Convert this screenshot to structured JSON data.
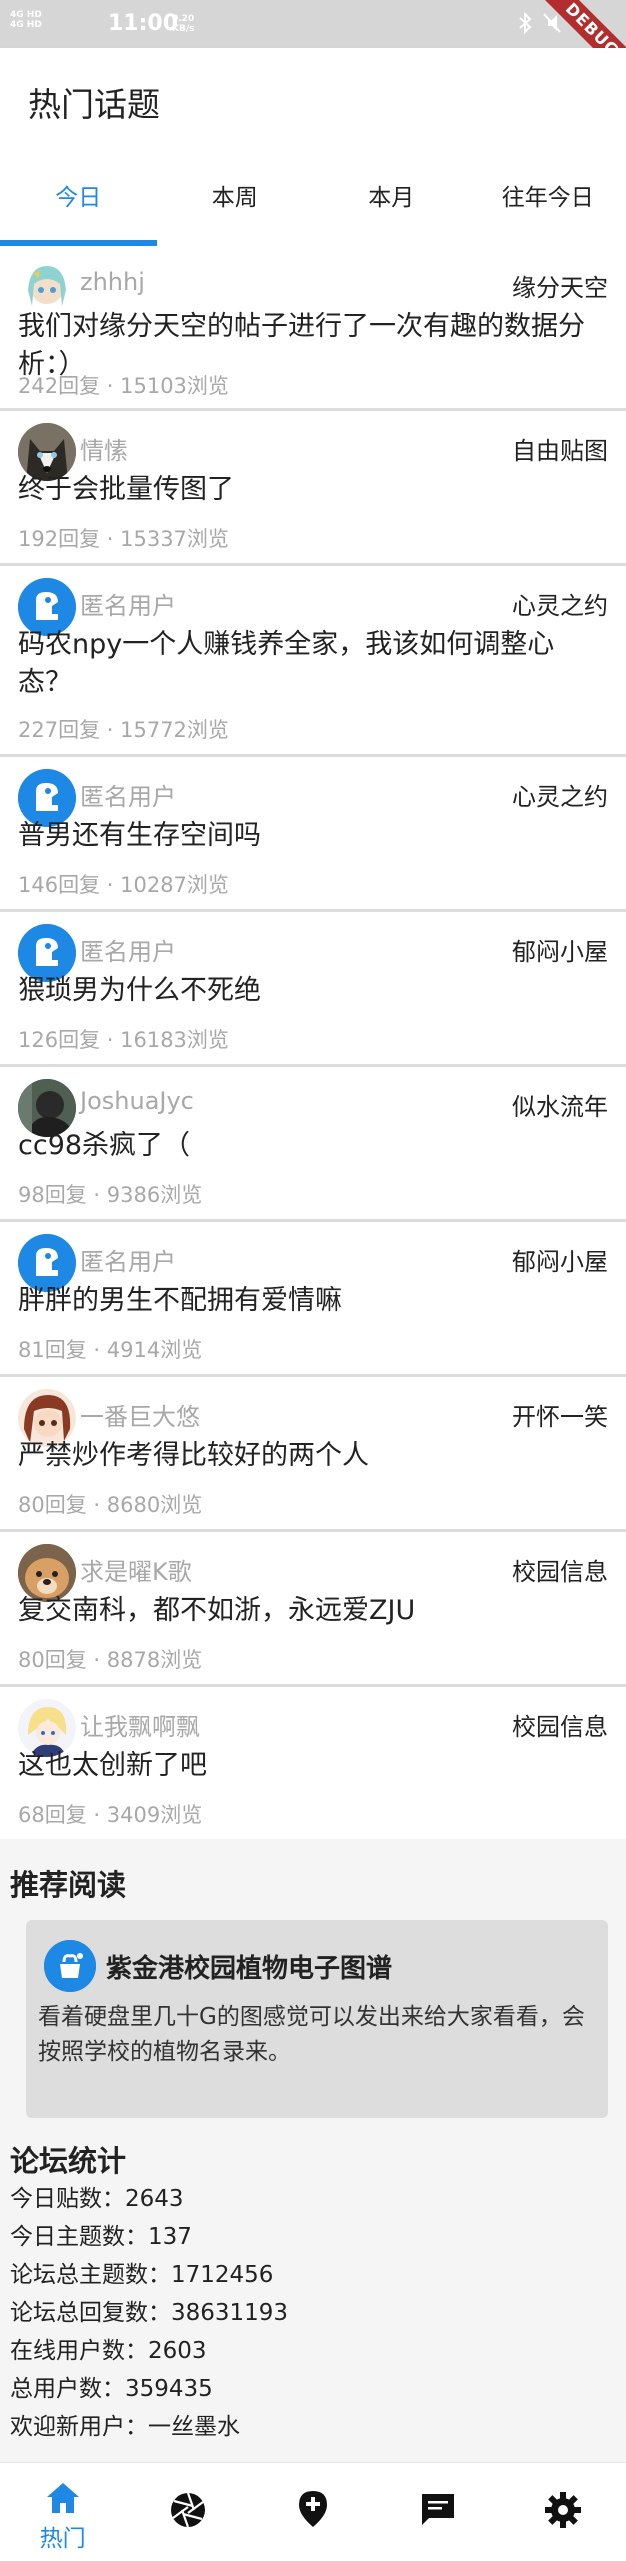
{
  "status_bar": {
    "net1": "4G HD",
    "net2": "4G HD",
    "time": "11:00",
    "speed_value": "0.20",
    "speed_unit": "KB/s",
    "debug_banner": "DEBUG"
  },
  "app_bar": {
    "title": "热门话题"
  },
  "tabs": [
    {
      "label": "今日",
      "active": true
    },
    {
      "label": "本周",
      "active": false
    },
    {
      "label": "本月",
      "active": false
    },
    {
      "label": "往年今日",
      "active": false
    }
  ],
  "topics": [
    {
      "user": "zhhhj",
      "board": "缘分天空",
      "title": "我们对缘分天空的帖子进行了一次有趣的数据分析：）",
      "meta": "242回复 · 15103浏览",
      "avatar": "anime-girl-avatar"
    },
    {
      "user": "情愫",
      "board": "自由贴图",
      "title": "终于会批量传图了",
      "meta": "192回复 · 15337浏览",
      "avatar": "husky-avatar"
    },
    {
      "user": "匿名用户",
      "board": "心灵之约",
      "title": "码农npy一个人赚钱养全家，我该如何调整心态？",
      "meta": "227回复 · 15772浏览",
      "avatar": "anonymous-avatar"
    },
    {
      "user": "匿名用户",
      "board": "心灵之约",
      "title": "普男还有生存空间吗",
      "meta": "146回复 · 10287浏览",
      "avatar": "anonymous-avatar"
    },
    {
      "user": "匿名用户",
      "board": "郁闷小屋",
      "title": "猥琐男为什么不死绝",
      "meta": "126回复 · 16183浏览",
      "avatar": "anonymous-avatar"
    },
    {
      "user": "JoshuaJyc",
      "board": "似水流年",
      "title": "cc98杀疯了（",
      "meta": "98回复 · 9386浏览",
      "avatar": "photo-avatar"
    },
    {
      "user": "匿名用户",
      "board": "郁闷小屋",
      "title": "胖胖的男生不配拥有爱情嘛",
      "meta": "81回复 · 4914浏览",
      "avatar": "anonymous-avatar"
    },
    {
      "user": "一番巨大悠",
      "board": "开怀一笑",
      "title": "严禁炒作考得比较好的两个人",
      "meta": "80回复 · 8680浏览",
      "avatar": "anime-girl-avatar"
    },
    {
      "user": "求是曜K歌",
      "board": "校园信息",
      "title": "复交南科，都不如浙，永远爱ZJU",
      "meta": "80回复 · 8878浏览",
      "avatar": "dog-avatar"
    },
    {
      "user": "让我飘啊飘",
      "board": "校园信息",
      "title": "这也太创新了吧",
      "meta": "68回复 · 3409浏览",
      "avatar": "anime-girl-avatar"
    }
  ],
  "recommended": {
    "section_title": "推荐阅读",
    "card_title": "紫金港校园植物电子图谱",
    "card_desc": "看着硬盘里几十G的图感觉可以发出来给大家看看，会按照学校的植物名录来。"
  },
  "stats": {
    "section_title": "论坛统计",
    "items": [
      "今日贴数：2643",
      "今日主题数：137",
      "论坛总主题数：1712456",
      "论坛总回复数：38631193",
      "在线用户数：2603",
      "总用户数：359435",
      "欢迎新用户：一丝墨水"
    ]
  },
  "bottom_nav": {
    "items": [
      {
        "icon": "home-icon",
        "label": "热门"
      },
      {
        "icon": "aperture-icon",
        "label": ""
      },
      {
        "icon": "location-add-icon",
        "label": ""
      },
      {
        "icon": "chat-icon",
        "label": ""
      },
      {
        "icon": "gear-icon",
        "label": ""
      }
    ]
  },
  "colors": {
    "accent": "#1e88e5",
    "muted": "#a8a8a8",
    "debug": "#b22d2d"
  }
}
